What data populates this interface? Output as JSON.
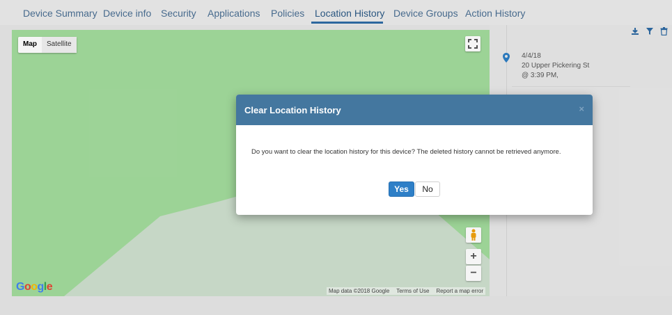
{
  "tabs": [
    {
      "label": "Device Summary"
    },
    {
      "label": "Device info"
    },
    {
      "label": "Security"
    },
    {
      "label": "Applications"
    },
    {
      "label": "Policies"
    },
    {
      "label": "Location History",
      "active": true
    },
    {
      "label": "Device Groups"
    },
    {
      "label": "Action History"
    }
  ],
  "map": {
    "type_map_label": "Map",
    "type_satellite_label": "Satellite",
    "fullscreen_icon": "fullscreen-icon",
    "pegman_icon": "pegman-icon",
    "zoom_in_label": "+",
    "zoom_out_label": "−",
    "logo_text": "Google",
    "attribution": {
      "data": "Map data ©2018 Google",
      "terms": "Terms of Use",
      "report": "Report a map error"
    }
  },
  "history_panel": {
    "toolbar_icons": [
      "download-icon",
      "filter-icon",
      "trash-icon"
    ],
    "entries": [
      {
        "date": "4/4/18",
        "address": "20 Upper Pickering St",
        "time": "@ 3:39 PM,"
      }
    ]
  },
  "modal": {
    "title": "Clear Location History",
    "close_label": "×",
    "message": "Do you want to clear the location history for this device? The deleted history cannot be retrieved anymore.",
    "yes_label": "Yes",
    "no_label": "No"
  },
  "colors": {
    "accent": "#2e7fc7",
    "modal_header": "#44779f",
    "tab_text": "#4a6f93",
    "map_green": "#a3dc9d"
  }
}
